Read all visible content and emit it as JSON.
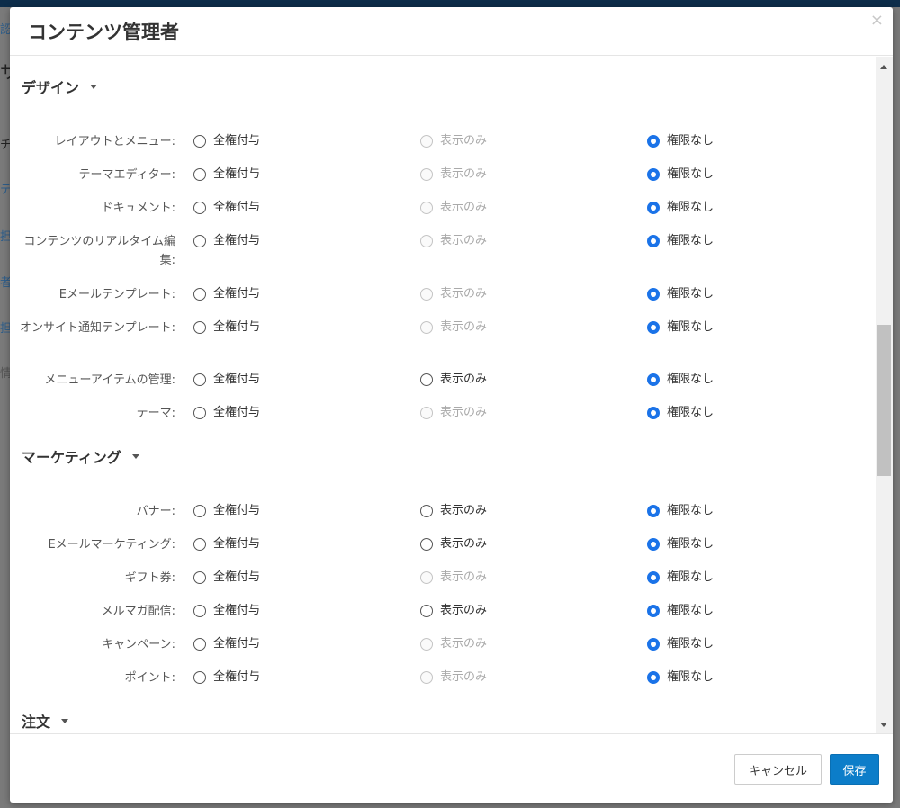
{
  "backdrop": {
    "fragments": [
      "認",
      "サ",
      "チ",
      "テ",
      "担",
      "者",
      "担",
      "情"
    ]
  },
  "modal": {
    "title": "コンテンツ管理者",
    "close_symbol": "×"
  },
  "options": {
    "full": "全権付与",
    "view": "表示のみ",
    "none": "権限なし"
  },
  "sections": [
    {
      "title": "デザイン",
      "rows": [
        {
          "label": "レイアウトとメニュー:",
          "selected": "none",
          "view_disabled": true
        },
        {
          "label": "テーマエディター:",
          "selected": "none",
          "view_disabled": true
        },
        {
          "label": "ドキュメント:",
          "selected": "none",
          "view_disabled": true
        },
        {
          "label": "コンテンツのリアルタイム編集:",
          "selected": "none",
          "view_disabled": true
        },
        {
          "label": "Eメールテンプレート:",
          "selected": "none",
          "view_disabled": true
        },
        {
          "label": "オンサイト通知テンプレート:",
          "selected": "none",
          "view_disabled": true
        },
        {
          "label": "メニューアイテムの管理:",
          "selected": "none",
          "view_disabled": false
        },
        {
          "label": "テーマ:",
          "selected": "none",
          "view_disabled": true
        }
      ]
    },
    {
      "title": "マーケティング",
      "rows": [
        {
          "label": "バナー:",
          "selected": "none",
          "view_disabled": false
        },
        {
          "label": "Eメールマーケティング:",
          "selected": "none",
          "view_disabled": false
        },
        {
          "label": "ギフト券:",
          "selected": "none",
          "view_disabled": true
        },
        {
          "label": "メルマガ配信:",
          "selected": "none",
          "view_disabled": false
        },
        {
          "label": "キャンペーン:",
          "selected": "none",
          "view_disabled": true
        },
        {
          "label": "ポイント:",
          "selected": "none",
          "view_disabled": true
        }
      ]
    },
    {
      "title": "注文",
      "rows": []
    }
  ],
  "footer": {
    "cancel_label": "キャンセル",
    "save_label": "保存"
  },
  "colors": {
    "accent": "#1b73e8",
    "save_button": "#0c7dc9",
    "disabled_text": "#aaaaaa"
  }
}
